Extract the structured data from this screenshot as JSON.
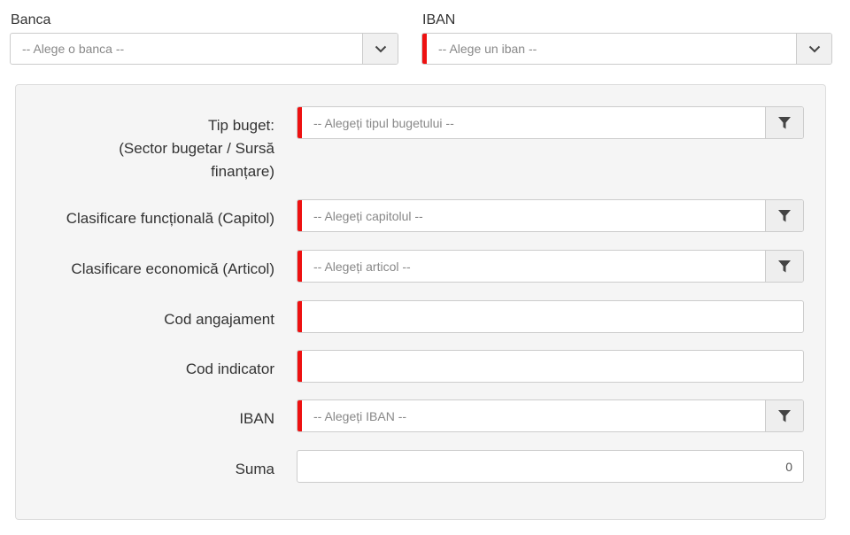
{
  "banca": {
    "label": "Banca",
    "placeholder": "-- Alege o banca --",
    "icon": "chevron-down-icon"
  },
  "iban_top": {
    "label": "IBAN",
    "placeholder": "-- Alege un iban --",
    "icon": "chevron-down-icon",
    "required": true
  },
  "form": {
    "tip_buget": {
      "label_line1": "Tip buget:",
      "label_line2": "(Sector bugetar / Sursă",
      "label_line3": "finanțare)",
      "placeholder": "-- Alegeți tipul bugetului --",
      "icon": "filter-icon",
      "required": true
    },
    "clasificare_functionala": {
      "label": "Clasificare funcțională (Capitol)",
      "placeholder": "-- Alegeți capitolul --",
      "icon": "filter-icon",
      "required": true
    },
    "clasificare_economica": {
      "label": "Clasificare economică (Articol)",
      "placeholder": "-- Alegeți articol --",
      "icon": "filter-icon",
      "required": true
    },
    "cod_angajament": {
      "label": "Cod angajament",
      "value": "",
      "required": true
    },
    "cod_indicator": {
      "label": "Cod indicator",
      "value": "",
      "required": true
    },
    "iban": {
      "label": "IBAN",
      "placeholder": "-- Alegeți IBAN --",
      "icon": "filter-icon",
      "required": true
    },
    "suma": {
      "label": "Suma",
      "value": "0"
    }
  },
  "colors": {
    "required_marker": "#ee1111",
    "panel_bg": "#f5f5f5",
    "border": "#cccccc"
  }
}
